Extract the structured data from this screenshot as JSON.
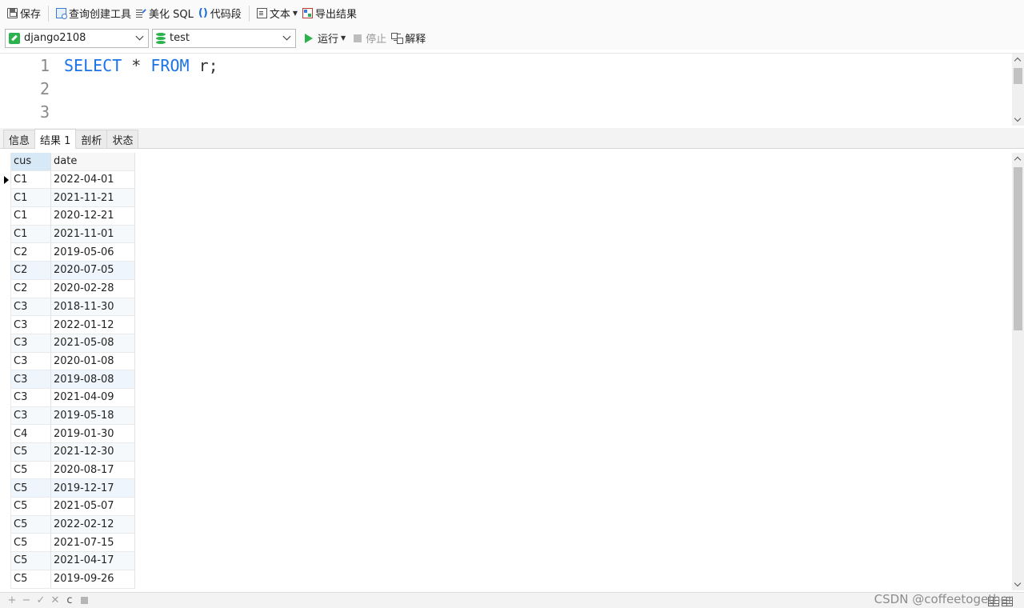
{
  "toolbar": {
    "save": "保存",
    "query_builder": "查询创建工具",
    "beautify_sql": "美化 SQL",
    "code_snippet": "代码段",
    "text": "文本",
    "export_results": "导出结果"
  },
  "connection": {
    "selected": "django2108"
  },
  "database": {
    "selected": "test"
  },
  "actions": {
    "run": "运行",
    "stop": "停止",
    "explain": "解释"
  },
  "editor": {
    "line_numbers": [
      "1",
      "2",
      "3"
    ],
    "keyword_select": "SELECT",
    "star": "*",
    "keyword_from": "FROM",
    "rest": "r;"
  },
  "tabs": [
    {
      "label": "信息"
    },
    {
      "label": "结果 1"
    },
    {
      "label": "剖析"
    },
    {
      "label": "状态"
    }
  ],
  "grid": {
    "columns": [
      "cus",
      "date"
    ],
    "rows": [
      [
        "C1",
        "2022-04-01"
      ],
      [
        "C1",
        "2021-11-21"
      ],
      [
        "C1",
        "2020-12-21"
      ],
      [
        "C1",
        "2021-11-01"
      ],
      [
        "C2",
        "2019-05-06"
      ],
      [
        "C2",
        "2020-07-05"
      ],
      [
        "C2",
        "2020-02-28"
      ],
      [
        "C3",
        "2018-11-30"
      ],
      [
        "C3",
        "2022-01-12"
      ],
      [
        "C3",
        "2021-05-08"
      ],
      [
        "C3",
        "2020-01-08"
      ],
      [
        "C3",
        "2019-08-08"
      ],
      [
        "C3",
        "2021-04-09"
      ],
      [
        "C3",
        "2019-05-18"
      ],
      [
        "C4",
        "2019-01-30"
      ],
      [
        "C5",
        "2021-12-30"
      ],
      [
        "C5",
        "2020-08-17"
      ],
      [
        "C5",
        "2019-12-17"
      ],
      [
        "C5",
        "2021-05-07"
      ],
      [
        "C5",
        "2022-02-12"
      ],
      [
        "C5",
        "2021-07-15"
      ],
      [
        "C5",
        "2021-04-17"
      ],
      [
        "C5",
        "2019-09-26"
      ]
    ]
  },
  "bottombar": {
    "add": "+",
    "delete": "−",
    "apply": "✓",
    "discard": "✕",
    "refresh": "c"
  },
  "watermark": "CSDN @coffeetogether",
  "icons": {
    "save": "save-icon",
    "query_builder": "query-builder-icon",
    "beautify": "beautify-icon",
    "snippet": "code-snippet-icon",
    "text": "text-icon",
    "export": "export-icon",
    "connection": "connection-icon",
    "database": "database-icon",
    "run": "play-icon",
    "stop": "stop-icon",
    "explain": "explain-icon"
  }
}
